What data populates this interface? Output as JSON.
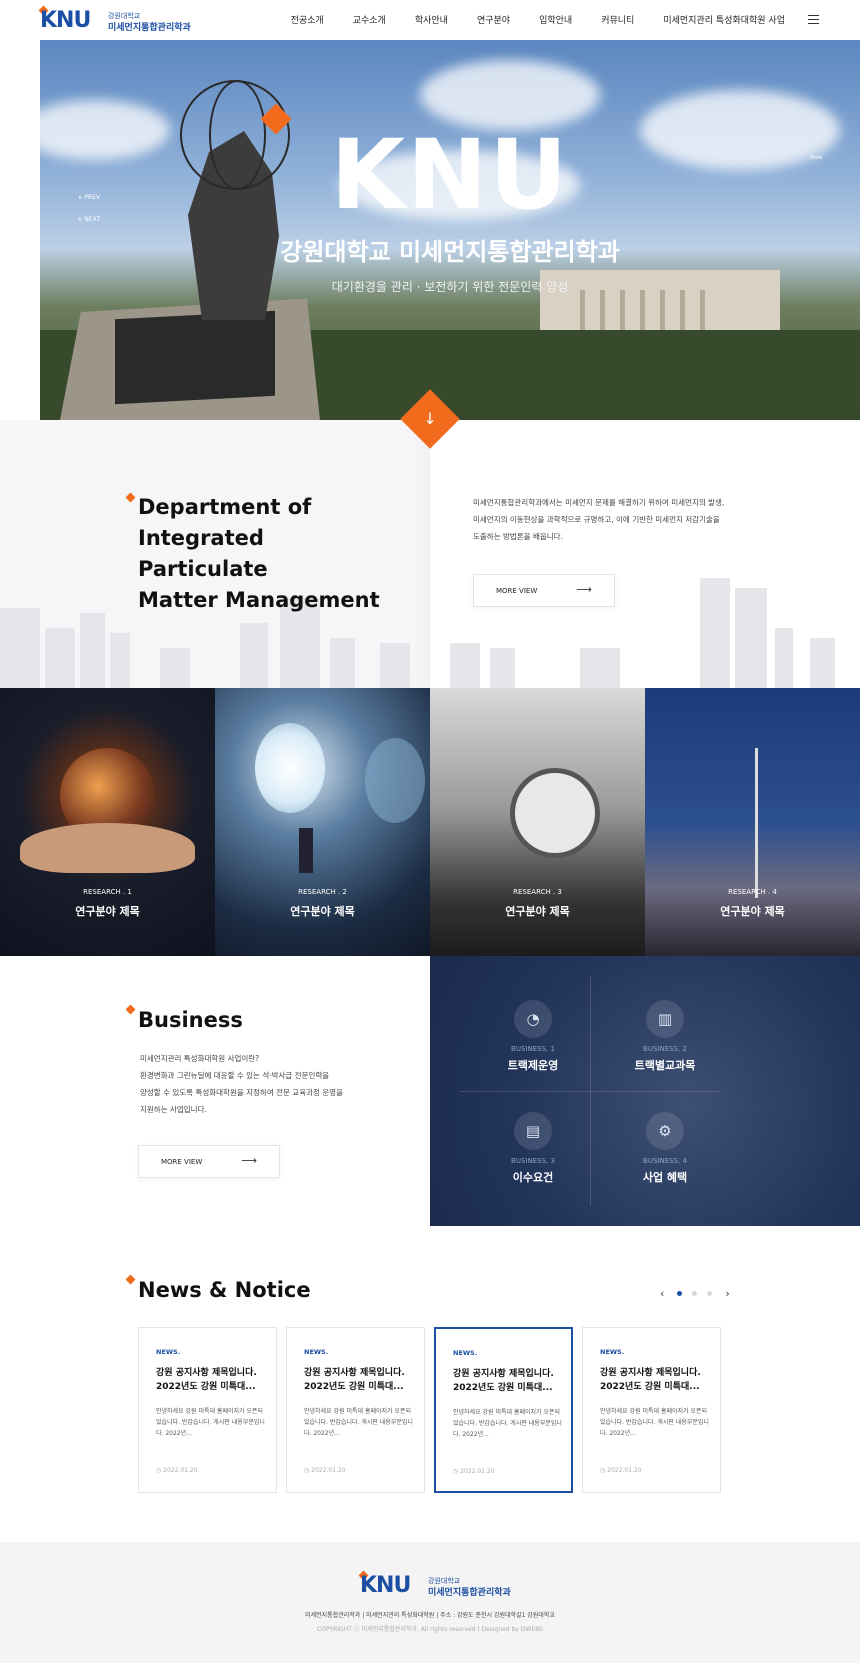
{
  "header": {
    "logo_text": "KNU",
    "logo_small": "강원대학교",
    "logo_main": "미세먼지통합관리학과",
    "nav": [
      "전공소개",
      "교수소개",
      "학사안내",
      "연구분야",
      "입학안내",
      "커뮤니티",
      "미세먼지관리 특성화대학원 사업"
    ]
  },
  "hero": {
    "big": "KNU",
    "title": "강원대학교 미세먼지통합관리학과",
    "subtitle": "대기환경을 관리 · 보전하기 위한 전문인력 양성",
    "prev": "∧  PREV",
    "next": "∨  NEXT",
    "more": "More"
  },
  "dept": {
    "title_lines": [
      "Department of",
      "Integrated Particulate",
      "Matter Management"
    ],
    "desc_lines": [
      "미세먼지통합관리학과에서는 미세먼지 문제를 해결하기 위하여 미세먼지의 발생,",
      "미세먼지의 이동현상을 과학적으로 규명하고, 이에 기반한 미세먼지 저감기술을",
      "도출하는 방법론을 배웁니다."
    ],
    "more": "MORE VIEW"
  },
  "research": [
    {
      "label": "RESEARCH . 1",
      "title": "연구분야 제목"
    },
    {
      "label": "RESEARCH . 2",
      "title": "연구분야 제목"
    },
    {
      "label": "RESEARCH . 3",
      "title": "연구분야 제목"
    },
    {
      "label": "RESEARCH . 4",
      "title": "연구분야 제목"
    }
  ],
  "business": {
    "title": "Business",
    "desc_lines": [
      "미세먼지관리 특성화대학원 사업이란?",
      "환경변화과 그린뉴딜에 대응할 수 있는 석·박사급 전문인력을",
      "양성할 수 있도록 특성화대학원을 지정하여 전문 교육과정 운영을",
      "지원하는 사업입니다."
    ],
    "more": "MORE VIEW",
    "items": [
      {
        "num": "BUSINESS. 1",
        "title": "트랙제운영",
        "icon": "pie-chart-icon"
      },
      {
        "num": "BUSINESS. 2",
        "title": "트랙별교과목",
        "icon": "bar-chart-icon"
      },
      {
        "num": "BUSINESS. 3",
        "title": "이수요건",
        "icon": "document-edit-icon"
      },
      {
        "num": "BUSINESS. 4",
        "title": "사업 혜택",
        "icon": "gear-icon"
      }
    ]
  },
  "news": {
    "title": "News & Notice",
    "prev": "‹",
    "next": "›",
    "cards": [
      {
        "tag": "NEWS.",
        "title": "강원 공지사항 제목입니다. 2022년도 강원 미특대...",
        "desc": "안녕하세요 강원 미특대 홈페이지가 오픈되었습니다. 반갑습니다. 게시판 내용부분입니다. 2022년...",
        "date": "2022.01.20"
      },
      {
        "tag": "NEWS.",
        "title": "강원 공지사항 제목입니다. 2022년도 강원 미특대...",
        "desc": "안녕하세요 강원 미특대 홈페이지가 오픈되었습니다. 반갑습니다. 게시판 내용부분입니다. 2022년...",
        "date": "2022.01.20"
      },
      {
        "tag": "NEWS.",
        "title": "강원 공지사항 제목입니다. 2022년도 강원 미특대...",
        "desc": "안녕하세요 강원 미특대 홈페이지가 오픈되었습니다. 반갑습니다. 게시판 내용부분입니다. 2022년...",
        "date": "2022.01.20"
      },
      {
        "tag": "NEWS.",
        "title": "강원 공지사항 제목입니다. 2022년도 강원 미특대...",
        "desc": "안녕하세요 강원 미특대 홈페이지가 오픈되었습니다. 반갑습니다. 게시판 내용부분입니다. 2022년...",
        "date": "2022.01.20"
      }
    ]
  },
  "footer": {
    "logo_text": "KNU",
    "logo_small": "강원대학교",
    "logo_main": "미세먼지통합관리학과",
    "info": "미세먼지통합관리학과   |   미세먼지관리 특성화대학원   |   주소 : 강원도 춘천시 강원대학길1 강원대학교",
    "copy": "COPYRIGHT ⓒ 미세먼지통합관리학과. All rights reserved     |     Designed by DWEBS"
  },
  "colors": {
    "brand": "#1c4fa3",
    "accent": "#f26a1b",
    "navy": "#22345a"
  }
}
